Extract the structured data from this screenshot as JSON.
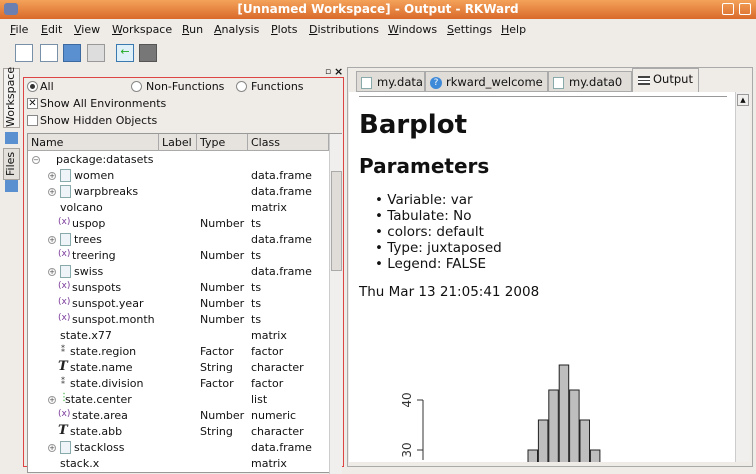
{
  "window": {
    "title": "[Unnamed Workspace] - Output - RKWard"
  },
  "menu": [
    "File",
    "Edit",
    "View",
    "Workspace",
    "Run",
    "Analysis",
    "Plots",
    "Distributions",
    "Windows",
    "Settings",
    "Help"
  ],
  "side_tabs": {
    "workspace": "Workspace",
    "files": "Files"
  },
  "filters": {
    "all": "All",
    "non_functions": "Non-Functions",
    "functions": "Functions",
    "show_all_env": "Show All Environments",
    "show_hidden": "Show Hidden Objects"
  },
  "columns": [
    "Name",
    "Label",
    "Type",
    "Class"
  ],
  "root": "package:datasets",
  "rows": [
    {
      "name": "women",
      "type": "",
      "class": "data.frame",
      "icon": "dataframe",
      "exp": true
    },
    {
      "name": "warpbreaks",
      "type": "",
      "class": "data.frame",
      "icon": "dataframe",
      "exp": true
    },
    {
      "name": "volcano",
      "type": "",
      "class": "matrix",
      "icon": "none",
      "exp": false
    },
    {
      "name": "uspop",
      "type": "Number",
      "class": "ts",
      "icon": "number",
      "exp": false
    },
    {
      "name": "trees",
      "type": "",
      "class": "data.frame",
      "icon": "dataframe",
      "exp": true
    },
    {
      "name": "treering",
      "type": "Number",
      "class": "ts",
      "icon": "number",
      "exp": false
    },
    {
      "name": "swiss",
      "type": "",
      "class": "data.frame",
      "icon": "dataframe",
      "exp": true
    },
    {
      "name": "sunspots",
      "type": "Number",
      "class": "ts",
      "icon": "number",
      "exp": false
    },
    {
      "name": "sunspot.year",
      "type": "Number",
      "class": "ts",
      "icon": "number",
      "exp": false
    },
    {
      "name": "sunspot.month",
      "type": "Number",
      "class": "ts",
      "icon": "number",
      "exp": false
    },
    {
      "name": "state.x77",
      "type": "",
      "class": "matrix",
      "icon": "none",
      "exp": false
    },
    {
      "name": "state.region",
      "type": "Factor",
      "class": "factor",
      "icon": "factor",
      "exp": false
    },
    {
      "name": "state.name",
      "type": "String",
      "class": "character",
      "icon": "string",
      "exp": false
    },
    {
      "name": "state.division",
      "type": "Factor",
      "class": "factor",
      "icon": "factor",
      "exp": false
    },
    {
      "name": "state.center",
      "type": "",
      "class": "list",
      "icon": "list",
      "exp": true
    },
    {
      "name": "state.area",
      "type": "Number",
      "class": "numeric",
      "icon": "number",
      "exp": false
    },
    {
      "name": "state.abb",
      "type": "String",
      "class": "character",
      "icon": "string",
      "exp": false
    },
    {
      "name": "stackloss",
      "type": "",
      "class": "data.frame",
      "icon": "dataframe",
      "exp": true
    },
    {
      "name": "stack.x",
      "type": "",
      "class": "matrix",
      "icon": "none",
      "exp": false
    }
  ],
  "tabs": [
    "my.data",
    "rkward_welcome",
    "my.data0",
    "Output"
  ],
  "output": {
    "title": "Barplot",
    "subtitle": "Parameters",
    "params": [
      "Variable: var",
      "Tabulate: No",
      "colors: default",
      "Type: juxtaposed",
      "Legend: FALSE"
    ],
    "date": "Thu Mar 13 21:05:41 2008"
  },
  "chart_data": {
    "type": "bar",
    "values": [
      30,
      36,
      42,
      47,
      42,
      36,
      30
    ],
    "yticks": [
      30,
      40
    ],
    "bar_color": "#bebebe"
  }
}
